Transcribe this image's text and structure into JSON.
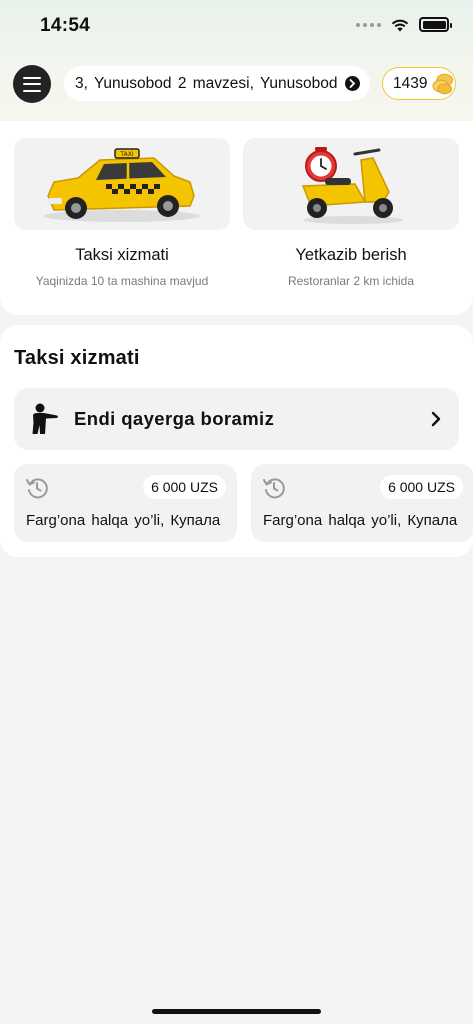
{
  "status_bar": {
    "time": "14:54"
  },
  "header": {
    "address": "3,  Yunusobod 2 mavzesi,  Yunusobod",
    "coins": "1439"
  },
  "services": [
    {
      "title": "Taksi xizmati",
      "subtitle": "Yaqinizda 10 ta mashina mavjud",
      "icon": "taxi-car"
    },
    {
      "title": "Yetkazib berish",
      "subtitle": "Restoranlar 2 km ichida",
      "icon": "delivery-scooter"
    }
  ],
  "taxi_section": {
    "title": "Taksi xizmati",
    "where_to": "Endi qayerga boramiz",
    "recent": [
      {
        "price": "6 000 UZS",
        "address": "Farg’ona halqa yo’li,  Купала"
      },
      {
        "price": "6 000 UZS",
        "address": "Farg’ona halqa yo’li,  Купала"
      }
    ]
  },
  "colors": {
    "accent": "#f2c733",
    "dark": "#232323",
    "card": "#f2f2f2"
  }
}
